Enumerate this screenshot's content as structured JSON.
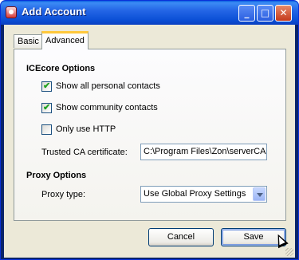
{
  "window": {
    "title": "Add Account",
    "minimize_label": "_",
    "maximize_label": "□",
    "close_label": "✕"
  },
  "tabs": [
    {
      "label": "Basic",
      "active": false
    },
    {
      "label": "Advanced",
      "active": true
    }
  ],
  "icecore": {
    "heading": "ICEcore Options",
    "options": [
      {
        "label": "Show all personal contacts",
        "checked": true
      },
      {
        "label": "Show community contacts",
        "checked": true
      },
      {
        "label": "Only use HTTP",
        "checked": false
      }
    ],
    "trusted_ca_label": "Trusted CA certificate:",
    "trusted_ca_value": "C:\\Program Files\\Zon\\serverCA."
  },
  "proxy": {
    "heading": "Proxy Options",
    "type_label": "Proxy type:",
    "type_value": "Use Global Proxy Settings"
  },
  "buttons": {
    "cancel": "Cancel",
    "save": "Save"
  },
  "colors": {
    "titlebar": "#2466e6",
    "dialog_bg": "#ece9d8",
    "tab_highlight": "#ffc83c",
    "check": "#21a121"
  }
}
